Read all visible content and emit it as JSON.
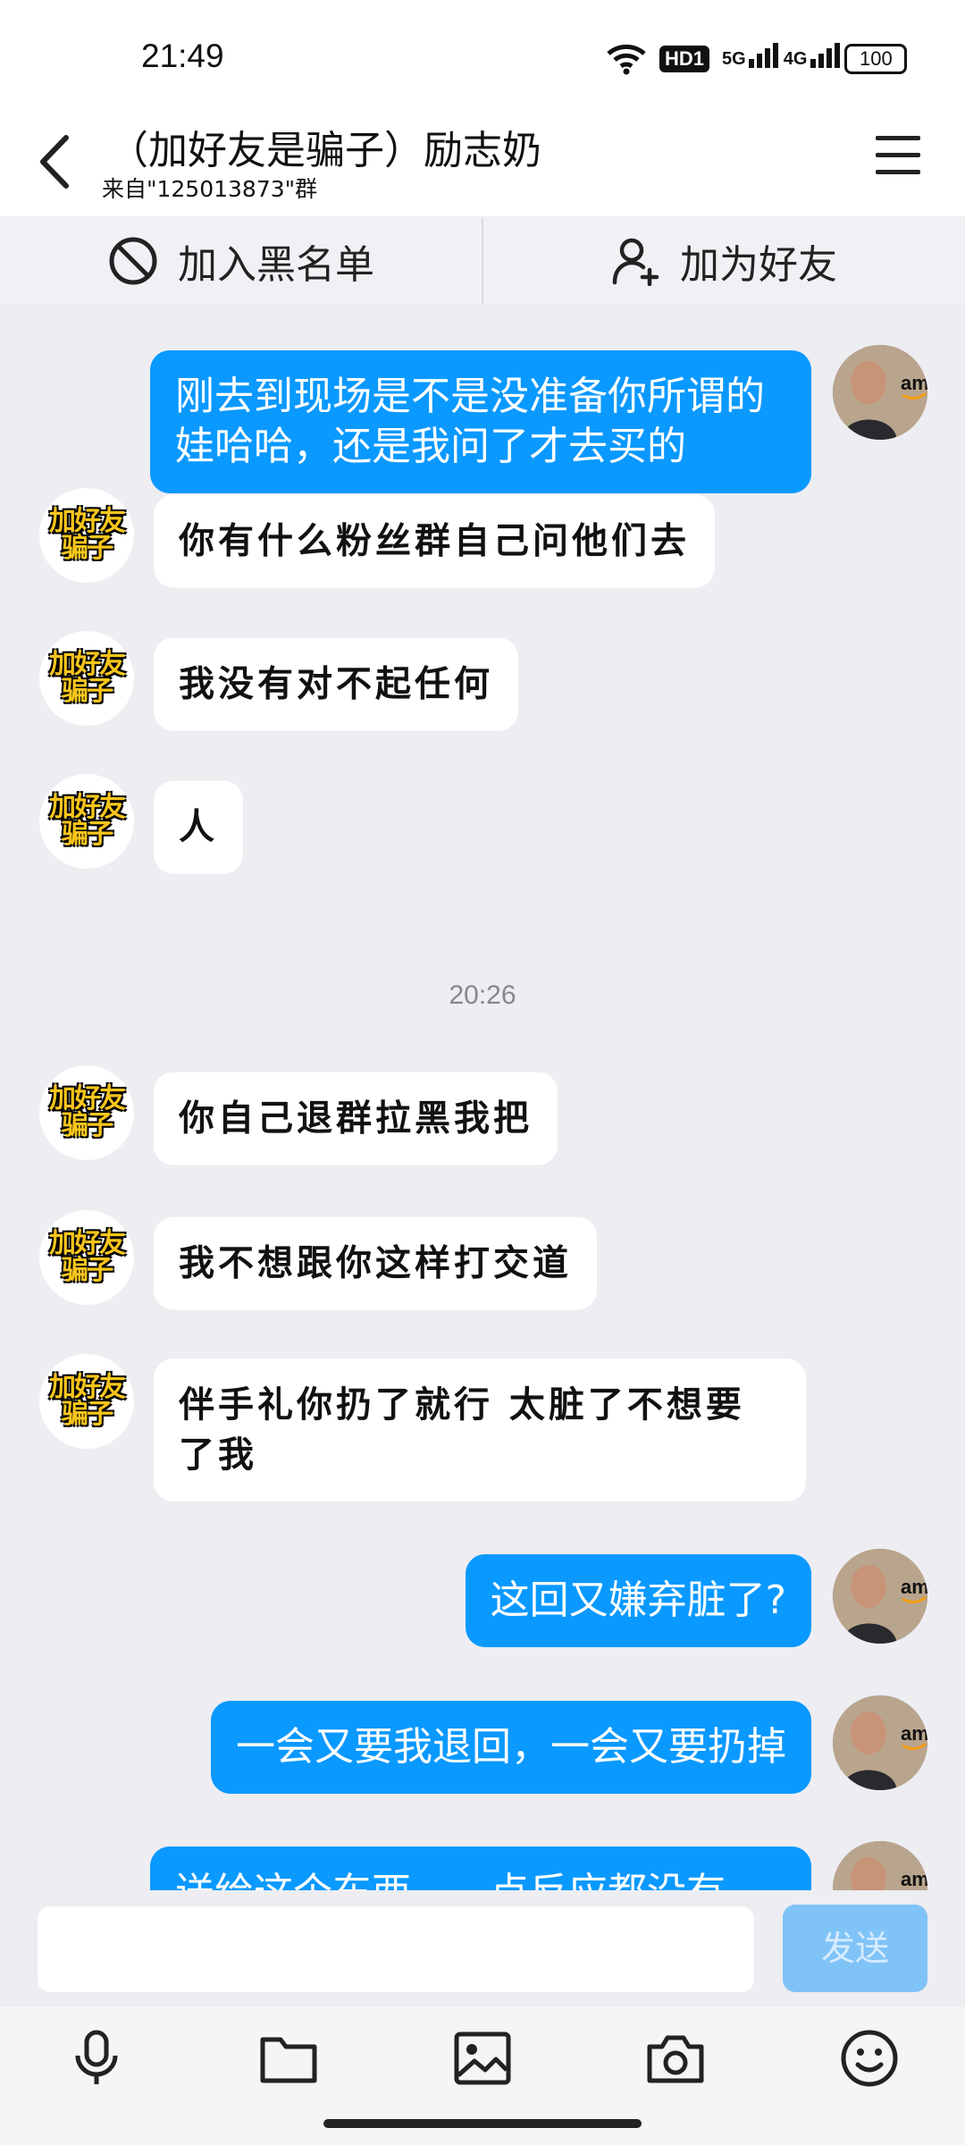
{
  "status_bar": {
    "time": "21:49",
    "network_hd": "HD1",
    "sim1": "5G",
    "sim2": "4G",
    "battery": "100",
    "icons": [
      "wifi-icon",
      "signal-icon",
      "battery-icon"
    ]
  },
  "header": {
    "title": "（加好友是骗子）励志奶",
    "subtitle": "来自\"125013873\"群",
    "icons": [
      "back-arrow-icon",
      "menu-icon"
    ]
  },
  "actions": {
    "blacklist_label": "加入黑名单",
    "add_friend_label": "加为好友",
    "icons": [
      "block-icon",
      "add-user-icon"
    ]
  },
  "avatar_bot_text": [
    "加好友",
    "骗子"
  ],
  "messages": {
    "m1": "刚去到现场是不是没准备你所谓的娃哈哈，还是我问了才去买的",
    "m2": "你有什么粉丝群自己问他们去",
    "m3": "我没有对不起任何",
    "m4": "人",
    "time1": "20:26",
    "m5": "你自己退群拉黑我把",
    "m6": "我不想跟你这样打交道",
    "m7": "伴手礼你扔了就行  太脏了不想要了我",
    "m8": "这回又嫌弃脏了?",
    "m9": "一会又要我退回，一会又要扔掉",
    "m10": "送给这个东西……点反应都没有"
  },
  "composer": {
    "input_value": "",
    "send_label": "发送"
  },
  "toolbar": {
    "icons": [
      "microphone-icon",
      "folder-icon",
      "image-icon",
      "camera-icon",
      "emoji-icon"
    ]
  },
  "colors": {
    "outgoing_bubble": "#0a99ff",
    "incoming_bubble": "#ffffff",
    "chat_background": "#ededf2",
    "send_button": "#80c3f7"
  }
}
